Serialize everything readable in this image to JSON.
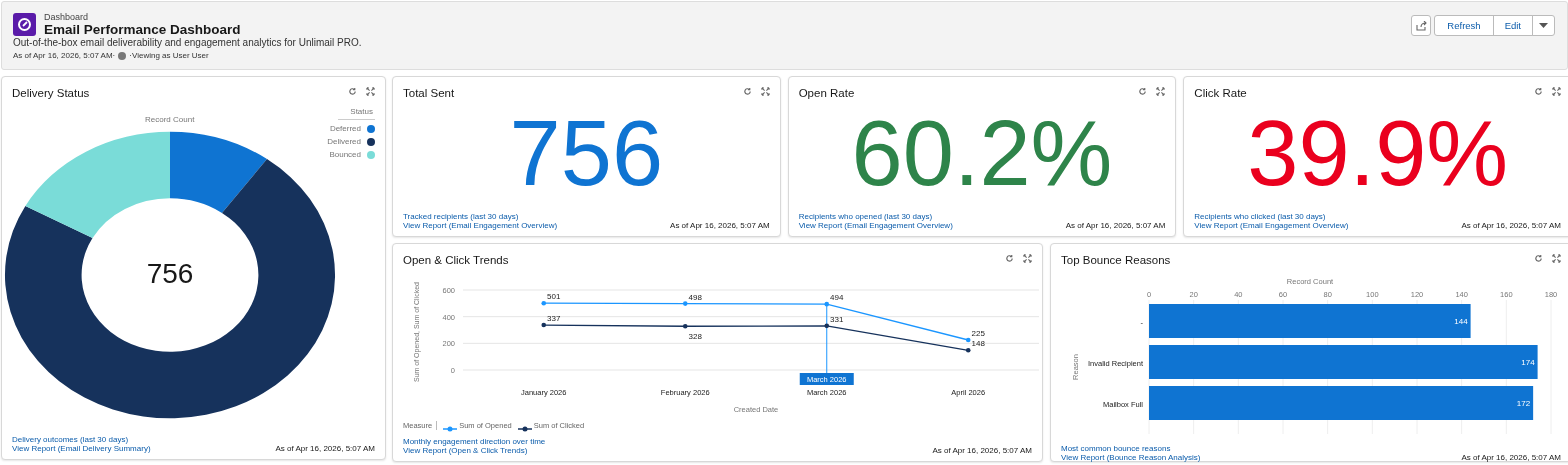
{
  "header": {
    "breadcrumb": "Dashboard",
    "title": "Email Performance Dashboard",
    "description": "Out-of-the-box email deliverability and engagement analytics for Unlimail PRO.",
    "as_of": "As of Apr 16, 2026, 5:07 AM·",
    "viewing": "·Viewing as User User",
    "buttons": [
      "Refresh",
      "Edit"
    ]
  },
  "widgets": [
    {
      "kind": "donut",
      "title": "Delivery Status",
      "center_value": "756",
      "legend": {
        "title": "Status",
        "items": [
          {
            "color": "#0f74d2"
          },
          {
            "color": "#16325c"
          },
          {
            "color": "#7adcd8"
          }
        ]
      },
      "chart_data": {
        "type": "donut",
        "title": "Record Count",
        "categories": [
          "Deferred",
          "Delivered",
          "Bounced"
        ],
        "values": [
          10,
          73,
          17
        ]
      },
      "footer": {
        "description": "Delivery outcomes (last 30 days)",
        "link": "View Report (Email Delivery Summary)",
        "timestamp": "As of Apr 16, 2026, 5:07 AM"
      }
    },
    {
      "kind": "metric",
      "title": "Total Sent",
      "value": "756",
      "color": "#0f74d2",
      "footer": {
        "description": "Tracked recipients (last 30 days)",
        "link": "View Report (Email Engagement Overview)",
        "timestamp": "As of Apr 16, 2026, 5:07 AM"
      }
    },
    {
      "kind": "metric",
      "title": "Open Rate",
      "value": "60.2%",
      "color": "#2e844a",
      "footer": {
        "description": "Recipients who opened (last 30 days)",
        "link": "View Report (Email Engagement Overview)",
        "timestamp": "As of Apr 16, 2026, 5:07 AM"
      }
    },
    {
      "kind": "metric",
      "title": "Click Rate",
      "value": "39.9%",
      "color": "#ea001e",
      "footer": {
        "description": "Recipients who clicked (last 30 days)",
        "link": "View Report (Email Engagement Overview)",
        "timestamp": "As of Apr 16, 2026, 5:07 AM"
      }
    },
    {
      "kind": "line",
      "title": "Open & Click Trends",
      "legend_title": "Measure",
      "chart_data": {
        "type": "line",
        "xlabel": "Created Date",
        "ylabel": "Sum of Opened, Sum of Clicked",
        "categories": [
          "January 2026",
          "February 2026",
          "March 2026",
          "April 2026"
        ],
        "series": [
          {
            "name": "Sum of Opened",
            "color": "#1b96ff",
            "values": [
              501,
              498,
              494,
              225
            ]
          },
          {
            "name": "Sum of Clicked",
            "color": "#16325c",
            "values": [
              337,
              328,
              331,
              148
            ]
          }
        ],
        "ylim": [
          0,
          600
        ],
        "yticks": [
          0,
          200,
          400,
          600
        ],
        "grid": true,
        "legend": "bottom",
        "data_labels": true,
        "annotations": [
          {
            "x": "March 2026",
            "text": "March 2026"
          }
        ]
      },
      "footer": {
        "description": "Monthly engagement direction over time",
        "link": "View Report (Open & Click Trends)",
        "timestamp": "As of Apr 16, 2026, 5:07 AM"
      }
    },
    {
      "kind": "bar",
      "title": "Top Bounce Reasons",
      "chart_data": {
        "type": "bar",
        "orientation": "horizontal",
        "ylabel": "Reason",
        "categories": [
          "-",
          "Invalid Recipient",
          "Mailbox Full"
        ],
        "series": [
          {
            "name": "Record Count",
            "color": "#0f74d2",
            "values": [
              144,
              174,
              172
            ]
          }
        ],
        "xlim": [
          0,
          180
        ],
        "xticks": [
          0,
          20,
          40,
          60,
          80,
          100,
          120,
          140,
          160,
          180
        ],
        "grid": true,
        "data_labels": true
      },
      "footer": {
        "description": "Most common bounce reasons",
        "link": "View Report (Bounce Reason Analysis)",
        "timestamp": "As of Apr 16, 2026, 5:07 AM"
      }
    }
  ]
}
